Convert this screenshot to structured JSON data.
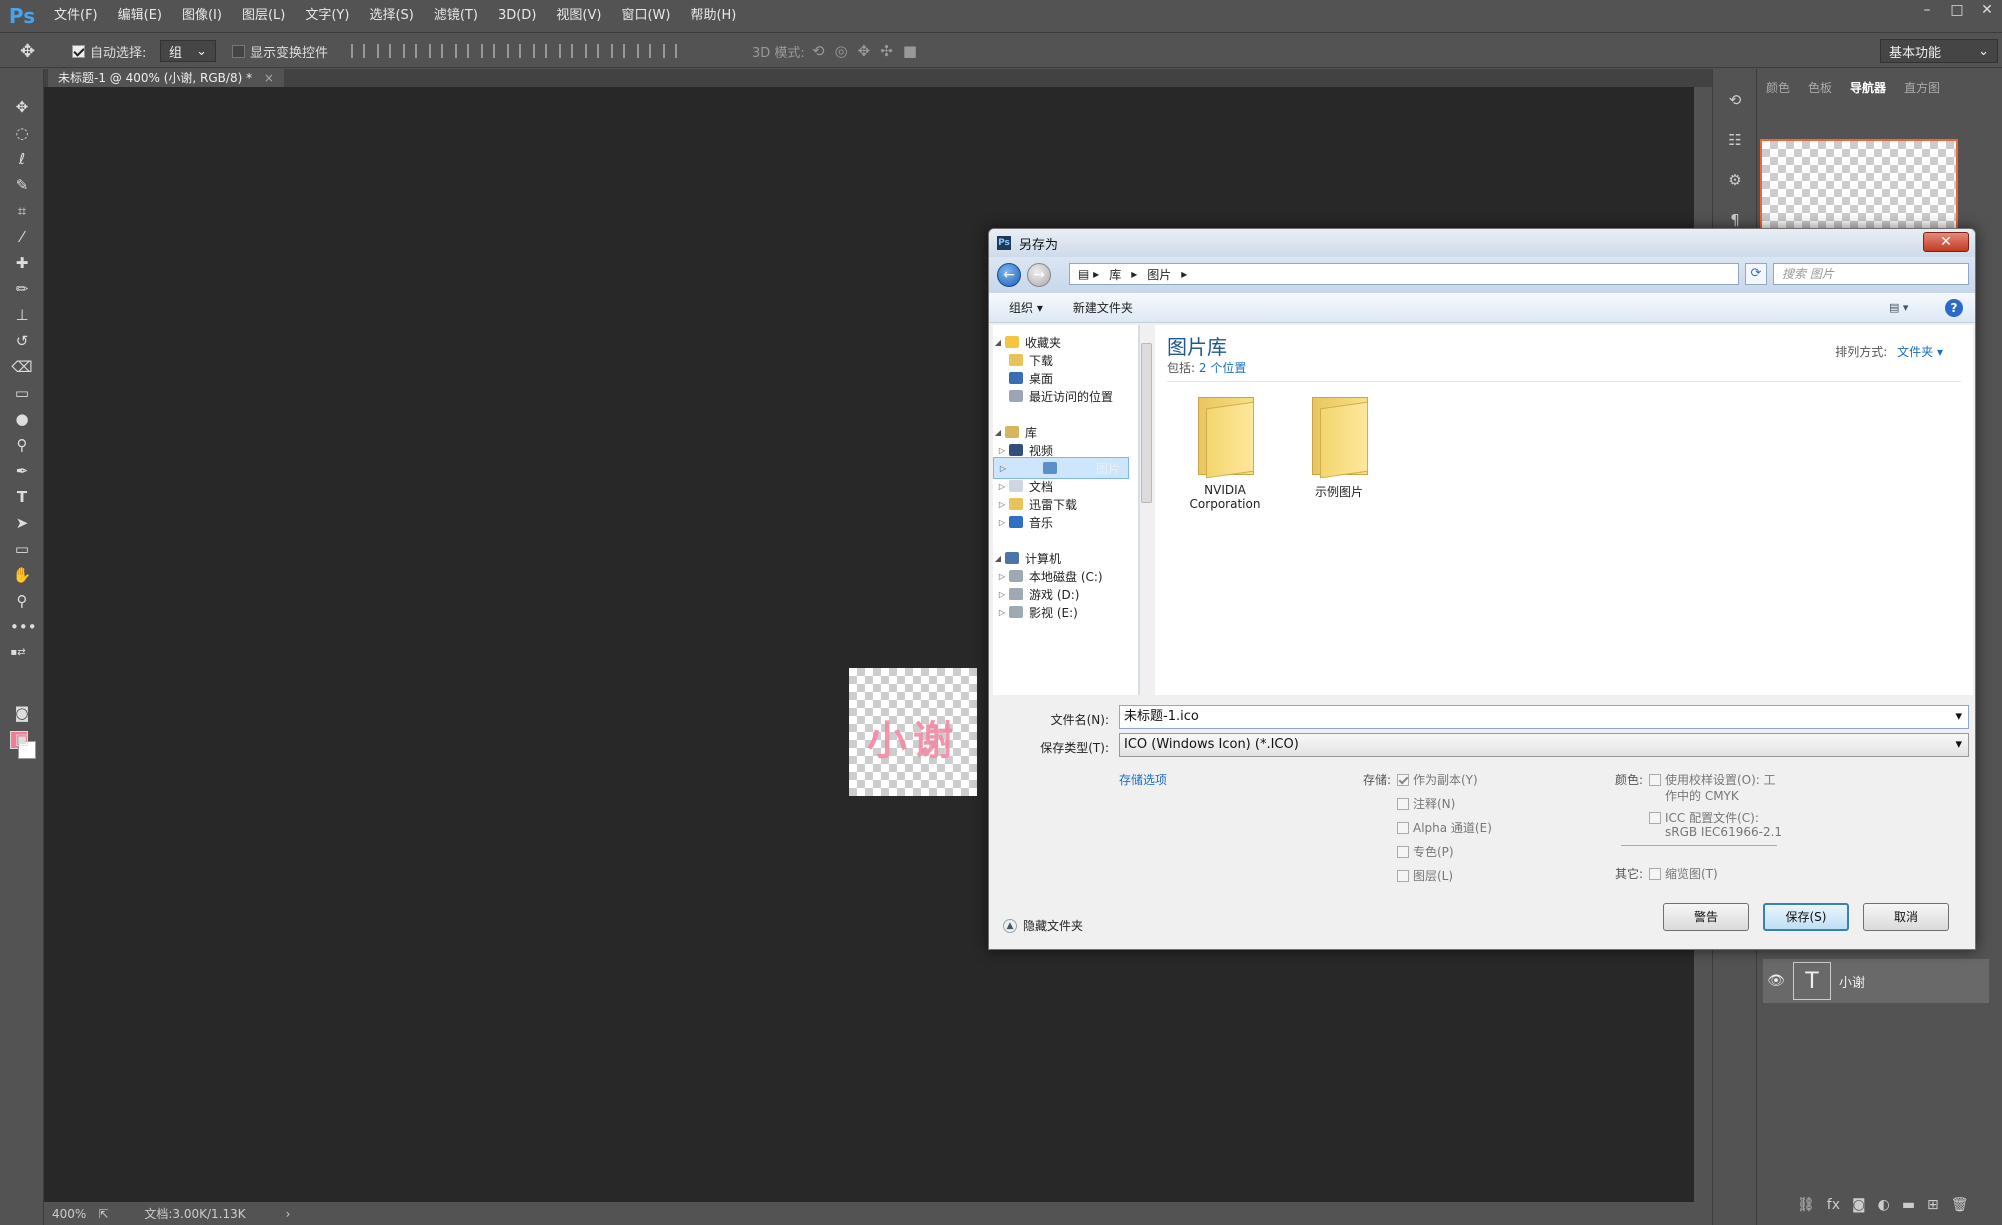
{
  "app": {
    "logo": "Ps"
  },
  "menu": [
    "文件(F)",
    "编辑(E)",
    "图像(I)",
    "图层(L)",
    "文字(Y)",
    "选择(S)",
    "滤镜(T)",
    "3D(D)",
    "视图(V)",
    "窗口(W)",
    "帮助(H)"
  ],
  "window_controls": {
    "min": "–",
    "max": "□",
    "close": "✕"
  },
  "options": {
    "auto_select_label": "自动选择:",
    "auto_select_value": "组",
    "show_transform_label": "显示变换控件",
    "mode3d_label": "3D 模式:",
    "workspace": "基本功能"
  },
  "document_tab": {
    "title": "未标题-1 @ 400% (小谢, RGB/8) *",
    "close": "×"
  },
  "canvas": {
    "doc_text": "小谢"
  },
  "status": {
    "zoom": "400%",
    "doc_size": "文档:3.00K/1.13K"
  },
  "panel_tabs": [
    "颜色",
    "色板",
    "导航器",
    "直方图"
  ],
  "layers": [
    {
      "name": "小谢",
      "kind": "T"
    }
  ],
  "dialog": {
    "title": "另存为",
    "close": "✕",
    "address": [
      "库",
      "图片"
    ],
    "search_placeholder": "搜索 图片",
    "toolbar": {
      "organize": "组织 ▾",
      "new_folder": "新建文件夹"
    },
    "nav": {
      "favorites": "收藏夹",
      "downloads": "下载",
      "desktop": "桌面",
      "recent": "最近访问的位置",
      "libraries": "库",
      "videos": "视频",
      "pictures": "图片",
      "documents": "文档",
      "thunder": "迅雷下载",
      "music": "音乐",
      "computer": "计算机",
      "disk_c": "本地磁盘 (C:)",
      "disk_d": "游戏 (D:)",
      "disk_e": "影视 (E:)"
    },
    "library_title": "图片库",
    "library_sub_label": "包括:",
    "library_sub_link": "2 个位置",
    "arrange_label": "排列方式:",
    "arrange_value": "文件夹 ▾",
    "folders": [
      "NVIDIA Corporation",
      "示例图片"
    ],
    "filename_label": "文件名(N):",
    "filename_value": "未标题-1.ico",
    "savetype_label": "保存类型(T):",
    "savetype_value": "ICO (Windows Icon) (*.ICO)",
    "save_options_link": "存储选项",
    "storage_label": "存储:",
    "storage_opts": [
      "作为副本(Y)",
      "注释(N)",
      "Alpha 通道(E)",
      "专色(P)",
      "图层(L)"
    ],
    "color_label": "颜色:",
    "proof_setup": "使用校样设置(O): 工",
    "proof_setup2": "作中的 CMYK",
    "icc_profile": "ICC 配置文件(C):",
    "icc_profile2": "sRGB IEC61966-2.1",
    "other_label": "其它:",
    "thumbnail": "缩览图(T)",
    "hide_folders": "隐藏文件夹",
    "buttons": {
      "warning": "警告",
      "save": "保存(S)",
      "cancel": "取消"
    }
  },
  "colors": {
    "foreground": "#f07c96",
    "background": "#ffffff",
    "accent": "#4aa3e8"
  }
}
